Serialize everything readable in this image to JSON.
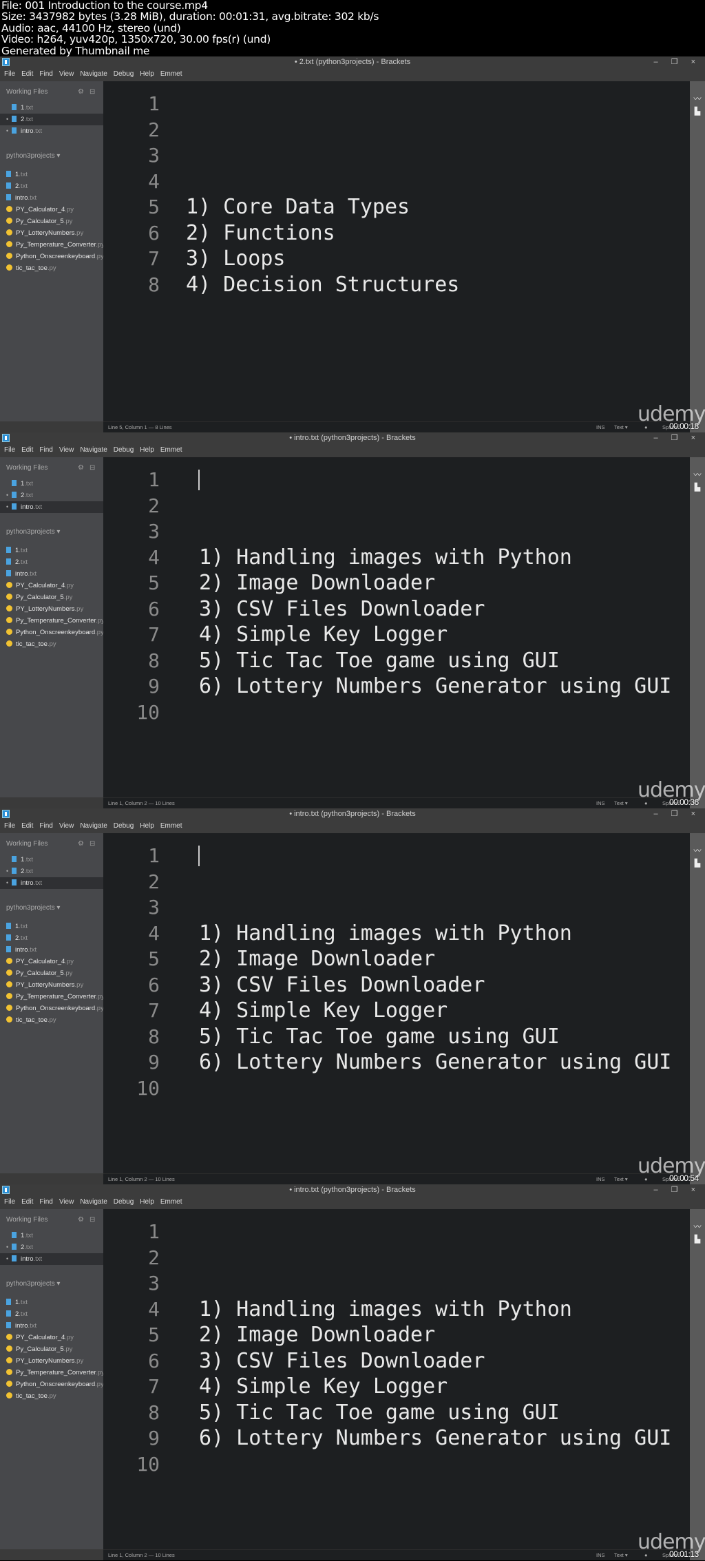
{
  "info_lines": [
    "File: 001 Introduction to the course.mp4",
    "Size: 3437982 bytes (3.28 MiB), duration: 00:01:31, avg.bitrate: 302 kb/s",
    "Audio: aac, 44100 Hz, stereo (und)",
    "Video: h264, yuv420p, 1350x720, 30.00 fps(r) (und)",
    "Generated by Thumbnail me"
  ],
  "menu": [
    "File",
    "Edit",
    "Find",
    "View",
    "Navigate",
    "Debug",
    "Help",
    "Emmet"
  ],
  "window_controls": "– ❐ ×",
  "sidebar": {
    "working_files_label": "Working Files",
    "project_label": "python3projects ▾",
    "project_files": [
      {
        "name": "1",
        "ext": ".txt",
        "icon": "file-icon"
      },
      {
        "name": "2",
        "ext": ".txt",
        "icon": "file-icon"
      },
      {
        "name": "intro",
        "ext": ".txt",
        "icon": "file-icon"
      },
      {
        "name": "PY_Calculator_4",
        "ext": ".py",
        "icon": "python-icon"
      },
      {
        "name": "Py_Calculator_5",
        "ext": ".py",
        "icon": "python-icon"
      },
      {
        "name": "PY_LotteryNumbers",
        "ext": ".py",
        "icon": "python-icon"
      },
      {
        "name": "Py_Temperature_Converter",
        "ext": ".py",
        "icon": "python-icon"
      },
      {
        "name": "Python_Onscreenkeyboard",
        "ext": ".py",
        "icon": "python-icon"
      },
      {
        "name": "tic_tac_toe",
        "ext": ".py",
        "icon": "python-icon"
      }
    ]
  },
  "status_right": {
    "ins": "INS",
    "mode": "Text ▾",
    "spaces": "Spaces: 4"
  },
  "watermark": "udemy",
  "frames": [
    {
      "title": "• 2.txt (python3projects) - Brackets",
      "working_files": [
        {
          "name": "1",
          "ext": ".txt",
          "dirty": false
        },
        {
          "name": "2",
          "ext": ".txt",
          "dirty": true
        },
        {
          "name": "intro",
          "ext": ".txt",
          "dirty": true
        }
      ],
      "selected_file": 1,
      "lines": [
        "",
        "",
        "",
        "",
        "1) Core Data Types",
        "2) Functions",
        "3) Loops",
        "4) Decision Structures"
      ],
      "cursor": false,
      "status": "Line 5, Column 1 — 8 Lines",
      "timestamp": "00:00:18"
    },
    {
      "title": "• intro.txt (python3projects) - Brackets",
      "working_files": [
        {
          "name": "1",
          "ext": ".txt",
          "dirty": false
        },
        {
          "name": "2",
          "ext": ".txt",
          "dirty": true
        },
        {
          "name": "intro",
          "ext": ".txt",
          "dirty": true
        }
      ],
      "selected_file": 2,
      "lines": [
        "",
        "",
        "",
        "1) Handling images with Python",
        "2) Image Downloader",
        "3) CSV Files Downloader",
        "4) Simple Key Logger",
        "5) Tic Tac Toe game using GUI",
        "6) Lottery Numbers Generator using GUI",
        ""
      ],
      "cursor": true,
      "status": "Line 1, Column 2 — 10 Lines",
      "timestamp": "00:00:36"
    },
    {
      "title": "• intro.txt (python3projects) - Brackets",
      "working_files": [
        {
          "name": "1",
          "ext": ".txt",
          "dirty": false
        },
        {
          "name": "2",
          "ext": ".txt",
          "dirty": true
        },
        {
          "name": "intro",
          "ext": ".txt",
          "dirty": true
        }
      ],
      "selected_file": 2,
      "lines": [
        "",
        "",
        "",
        "1) Handling images with Python",
        "2) Image Downloader",
        "3) CSV Files Downloader",
        "4) Simple Key Logger",
        "5) Tic Tac Toe game using GUI",
        "6) Lottery Numbers Generator using GUI",
        ""
      ],
      "cursor": true,
      "status": "Line 1, Column 2 — 10 Lines",
      "timestamp": "00:00:54"
    },
    {
      "title": "• intro.txt (python3projects) - Brackets",
      "working_files": [
        {
          "name": "1",
          "ext": ".txt",
          "dirty": false
        },
        {
          "name": "2",
          "ext": ".txt",
          "dirty": true
        },
        {
          "name": "intro",
          "ext": ".txt",
          "dirty": true
        }
      ],
      "selected_file": 2,
      "lines": [
        "",
        "",
        "",
        "1) Handling images with Python",
        "2) Image Downloader",
        "3) CSV Files Downloader",
        "4) Simple Key Logger",
        "5) Tic Tac Toe game using GUI",
        "6) Lottery Numbers Generator using GUI",
        ""
      ],
      "cursor": false,
      "status": "Line 1, Column 2 — 10 Lines",
      "timestamp": "00:01:13"
    }
  ]
}
